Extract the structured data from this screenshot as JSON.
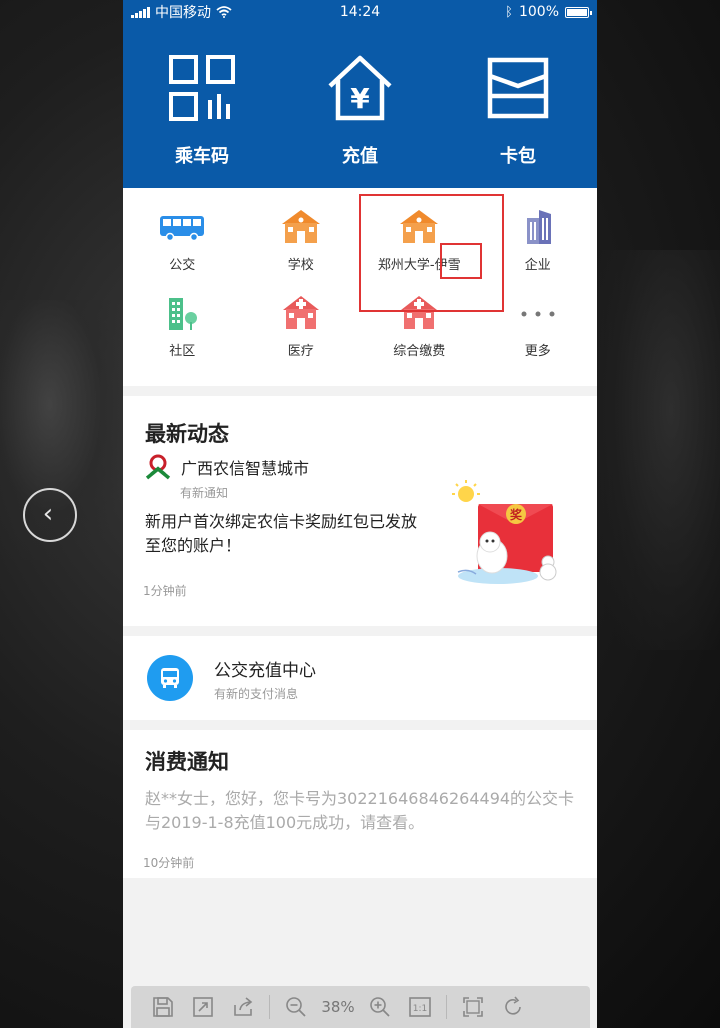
{
  "status_bar": {
    "carrier": "中国移动",
    "time": "14:24",
    "battery": "100%"
  },
  "hero": {
    "items": [
      {
        "label": "乘车码",
        "icon": "qr-code-icon"
      },
      {
        "label": "充值",
        "icon": "house-yuan-icon"
      },
      {
        "label": "卡包",
        "icon": "card-wallet-icon"
      }
    ]
  },
  "grid": {
    "items": [
      {
        "label": "公交",
        "icon": "bus-icon"
      },
      {
        "label": "学校",
        "icon": "school-icon"
      },
      {
        "label": "郑州大学-伊雪",
        "icon": "school-icon"
      },
      {
        "label": "企业",
        "icon": "enterprise-icon"
      },
      {
        "label": "社区",
        "icon": "community-icon"
      },
      {
        "label": "医疗",
        "icon": "hospital-icon"
      },
      {
        "label": "综合缴费",
        "icon": "payment-icon"
      },
      {
        "label": "更多",
        "icon": "more-dots-icon"
      }
    ]
  },
  "news": {
    "title": "最新动态",
    "org": "广西农信智慧城市",
    "subtitle": "有新通知",
    "body": "新用户首次绑定农信卡奖励红包已发放至您的账户！",
    "time": "1分钟前",
    "envelope_char": "奖"
  },
  "bus_center": {
    "title": "公交充值中心",
    "subtitle": "有新的支付消息"
  },
  "consume": {
    "title": "消费通知",
    "body": "赵**女士，您好，您卡号为30221646846264494的公交卡与2019-1-8充值100元成功，请查看。",
    "time": "10分钟前"
  },
  "viewer": {
    "zoom": "38%",
    "actual_size": "1:1"
  },
  "colors": {
    "brand_blue": "#0a5aa8",
    "highlight_red": "#e03434",
    "bus_blue": "#1f9cf0"
  }
}
